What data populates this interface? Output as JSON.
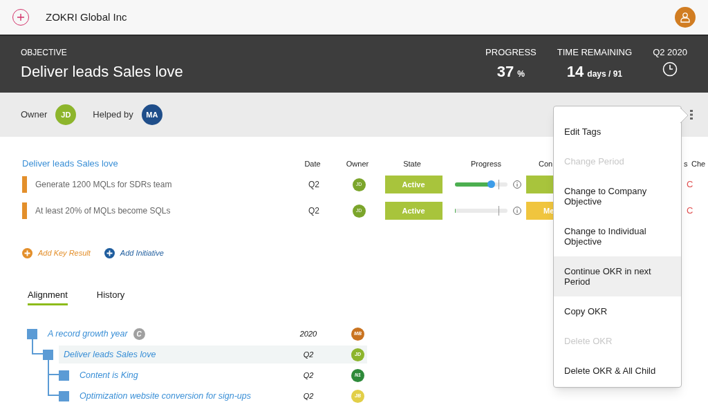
{
  "top_bar": {
    "company": "ZOKRI Global Inc"
  },
  "objective": {
    "label": "OBJECTIVE",
    "title": "Deliver leads Sales love",
    "stats": [
      {
        "kind": "number",
        "label": "PROGRESS",
        "value": "37",
        "unit": "%"
      },
      {
        "kind": "number",
        "label": "TIME REMAINING",
        "value": "14",
        "unit": "days / 91"
      },
      {
        "kind": "clock",
        "label": "Q2 2020"
      }
    ]
  },
  "people": {
    "owner_label": "Owner",
    "owner": {
      "initials": "JD",
      "color": "#8db52c"
    },
    "helper_label": "Helped by",
    "helper": {
      "initials": "MA",
      "color": "#1f4e8a"
    }
  },
  "key_results": {
    "title": "Deliver leads Sales love",
    "columns": [
      "Date",
      "Owner",
      "State",
      "Progress",
      "Con",
      "s",
      "Che"
    ],
    "rows": [
      {
        "name": "Generate 1200 MQLs for SDRs team",
        "date": "Q2",
        "owner": "JD",
        "state": "Active",
        "level": 0.68,
        "confidence": {
          "color": "#a8c43c"
        },
        "check": "C"
      },
      {
        "name": "At least 20% of MQLs become SQLs",
        "date": "Q2",
        "owner": "JD",
        "state": "Active",
        "level": 0,
        "confidence": {
          "text": "Me",
          "color": "#f0c53e"
        },
        "check": "C"
      }
    ]
  },
  "add_links": [
    {
      "kind": "key_result",
      "label": "Add Key Result"
    },
    {
      "kind": "initiative",
      "label": "Add Initiative"
    }
  ],
  "tabs": [
    {
      "label": "Alignment",
      "selected": true
    },
    {
      "label": "History",
      "selected": false
    }
  ],
  "alignment": [
    {
      "title": "A record growth year",
      "badge": "C",
      "date": "2020",
      "owner": {
        "initials": "MB",
        "color": "#c9731f"
      },
      "selected": false,
      "children": [
        {
          "title": "Deliver leads Sales love",
          "date": "Q2",
          "owner": {
            "initials": "JD",
            "color": "#8db52c"
          },
          "selected": true,
          "children": [
            {
              "title": "Content is King",
              "date": "Q2",
              "owner": {
                "initials": "N1",
                "color": "#2e8a3a"
              },
              "selected": false
            },
            {
              "title": "Optimization website conversion for sign-ups",
              "date": "Q2",
              "owner": {
                "initials": "JB",
                "color": "#e2cf48"
              },
              "selected": false
            }
          ]
        }
      ]
    }
  ],
  "menu": [
    {
      "label": "Edit Tags",
      "disabled": false,
      "highlighted": false
    },
    {
      "label": "Change Period",
      "disabled": true,
      "highlighted": false
    },
    {
      "label": "Change to Company Objective",
      "disabled": false,
      "highlighted": false
    },
    {
      "label": "Change to Individual Objective",
      "disabled": false,
      "highlighted": false
    },
    {
      "label": "Continue OKR in next Period",
      "disabled": false,
      "highlighted": true
    },
    {
      "label": "Copy OKR",
      "disabled": false,
      "highlighted": false
    },
    {
      "label": "Delete OKR",
      "disabled": true,
      "highlighted": false
    },
    {
      "label": "Delete OKR & All Child",
      "disabled": false,
      "highlighted": false
    }
  ]
}
